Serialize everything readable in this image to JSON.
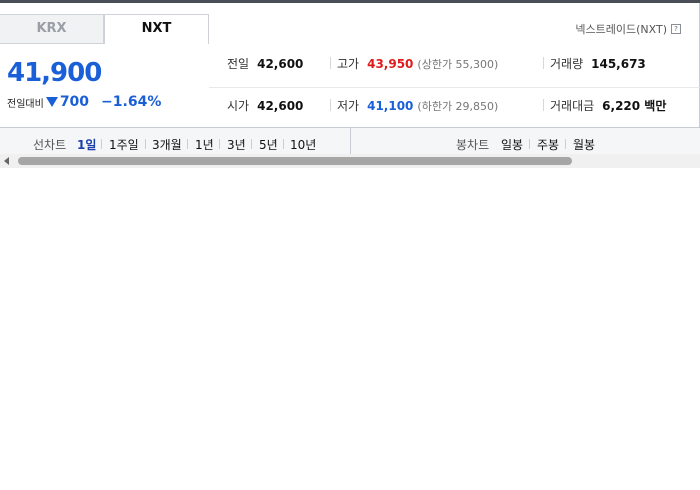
{
  "tabs": {
    "krx": "KRX",
    "nxt": "NXT"
  },
  "header": {
    "title": "넥스트레이드(NXT)",
    "help": "?"
  },
  "price": {
    "current": "41,900",
    "change_label": "전일대비",
    "change": "700",
    "change_pct": "−1.64%"
  },
  "stats": {
    "prev_close": {
      "label": "전일",
      "value": "42,600"
    },
    "high": {
      "label": "고가",
      "value": "43,950",
      "limit_label": "(상한가 55,300)"
    },
    "volume": {
      "label": "거래량",
      "value": "145,673"
    },
    "open": {
      "label": "시가",
      "value": "42,600"
    },
    "low": {
      "label": "저가",
      "value": "41,100",
      "limit_label": "(하한가 29,850)"
    },
    "amount": {
      "label": "거래대금",
      "value": "6,220 백만"
    }
  },
  "chart_controls": {
    "line_label": "선차트",
    "periods": [
      "1일",
      "1주일",
      "3개월",
      "1년",
      "3년",
      "5년",
      "10년"
    ],
    "candle_label": "봉차트",
    "candles": [
      "일봉",
      "주봉",
      "월봉"
    ]
  },
  "colors": {
    "up": "#e01b1b",
    "down": "#1a5fd8",
    "active": "#1a3fa8"
  }
}
